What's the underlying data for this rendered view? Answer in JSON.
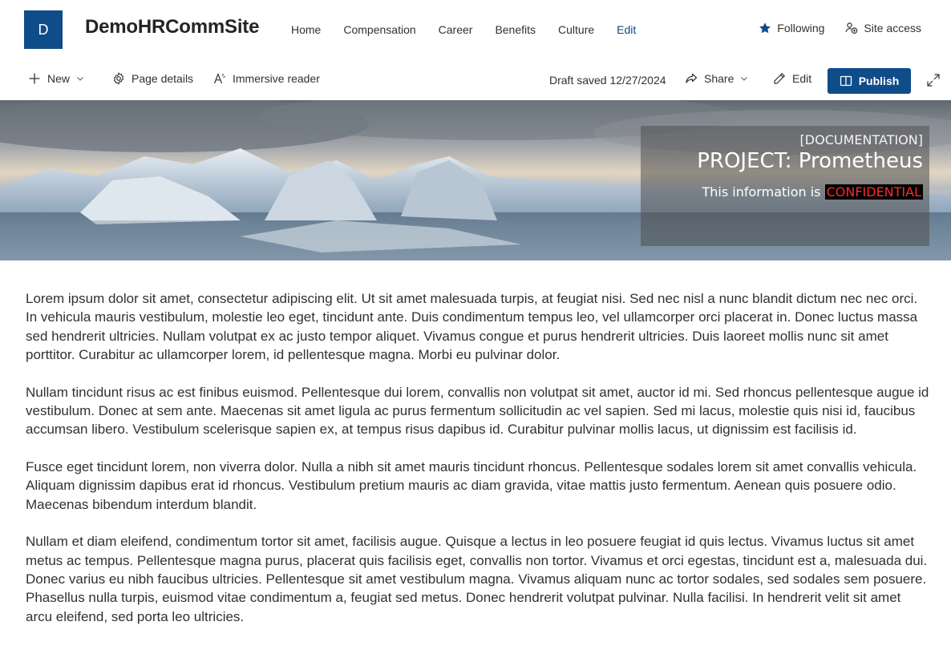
{
  "site": {
    "logo_letter": "D",
    "title": "DemoHRCommSite",
    "nav": [
      "Home",
      "Compensation",
      "Career",
      "Benefits",
      "Culture",
      "Edit"
    ],
    "following_label": "Following",
    "site_access_label": "Site access"
  },
  "command_bar": {
    "new_label": "New",
    "page_details_label": "Page details",
    "immersive_reader_label": "Immersive reader",
    "draft_status": "Draft saved 12/27/2024",
    "share_label": "Share",
    "edit_label": "Edit",
    "publish_label": "Publish"
  },
  "hero": {
    "label": "[DOCUMENTATION]",
    "title": "PROJECT: Prometheus",
    "info_prefix": "This information is ",
    "info_highlight": "CONFIDENTIAL"
  },
  "body": {
    "paragraphs": [
      "Lorem ipsum dolor sit amet, consectetur adipiscing elit. Ut sit amet malesuada turpis, at feugiat nisi. Sed nec nisl a nunc blandit dictum nec nec orci. In vehicula mauris vestibulum, molestie leo eget, tincidunt ante. Duis condimentum tempus leo, vel ullamcorper orci placerat in. Donec luctus massa sed hendrerit ultricies. Nullam volutpat ex ac justo tempor aliquet. Vivamus congue et purus hendrerit ultricies. Duis laoreet mollis nunc sit amet porttitor. Curabitur ac ullamcorper lorem, id pellentesque magna. Morbi eu pulvinar dolor.",
      "Nullam tincidunt risus ac est finibus euismod. Pellentesque dui lorem, convallis non volutpat sit amet, auctor id mi. Sed rhoncus pellentesque augue id vestibulum. Donec at sem ante. Maecenas sit amet ligula ac purus fermentum sollicitudin ac vel sapien. Sed mi lacus, molestie quis nisi id, faucibus accumsan libero. Vestibulum scelerisque sapien ex, at tempus risus dapibus id. Curabitur pulvinar mollis lacus, ut dignissim est facilisis id.",
      "Fusce eget tincidunt lorem, non viverra dolor. Nulla a nibh sit amet mauris tincidunt rhoncus. Pellentesque sodales lorem sit amet convallis vehicula. Aliquam dignissim dapibus erat id rhoncus. Vestibulum pretium mauris ac diam gravida, vitae mattis justo fermentum. Aenean quis posuere odio. Maecenas bibendum interdum blandit.",
      "Nullam et diam eleifend, condimentum tortor sit amet, facilisis augue. Quisque a lectus in leo posuere feugiat id quis lectus. Vivamus luctus sit amet metus ac tempus. Pellentesque magna purus, placerat quis facilisis eget, convallis non tortor. Vivamus et orci egestas, tincidunt est a, malesuada dui. Donec varius eu nibh faucibus ultricies. Pellentesque sit amet vestibulum magna. Vivamus aliquam nunc ac tortor sodales, sed sodales sem posuere. Phasellus nulla turpis, euismod vitae condimentum a, feugiat sed metus. Donec hendrerit volutpat pulvinar. Nulla facilisi. In hendrerit velit sit amet arcu eleifend, sed porta leo ultricies."
    ]
  },
  "colors": {
    "brand": "#0f4c8a",
    "text": "#323130",
    "confidential_text": "#ff2a2a",
    "confidential_bg": "#000000"
  },
  "icons": [
    "star-filled-icon",
    "site-access-icon",
    "plus-icon",
    "chevron-down-icon",
    "gear-icon",
    "immersive-reader-icon",
    "share-icon",
    "pencil-icon",
    "book-open-icon",
    "expand-icon"
  ]
}
